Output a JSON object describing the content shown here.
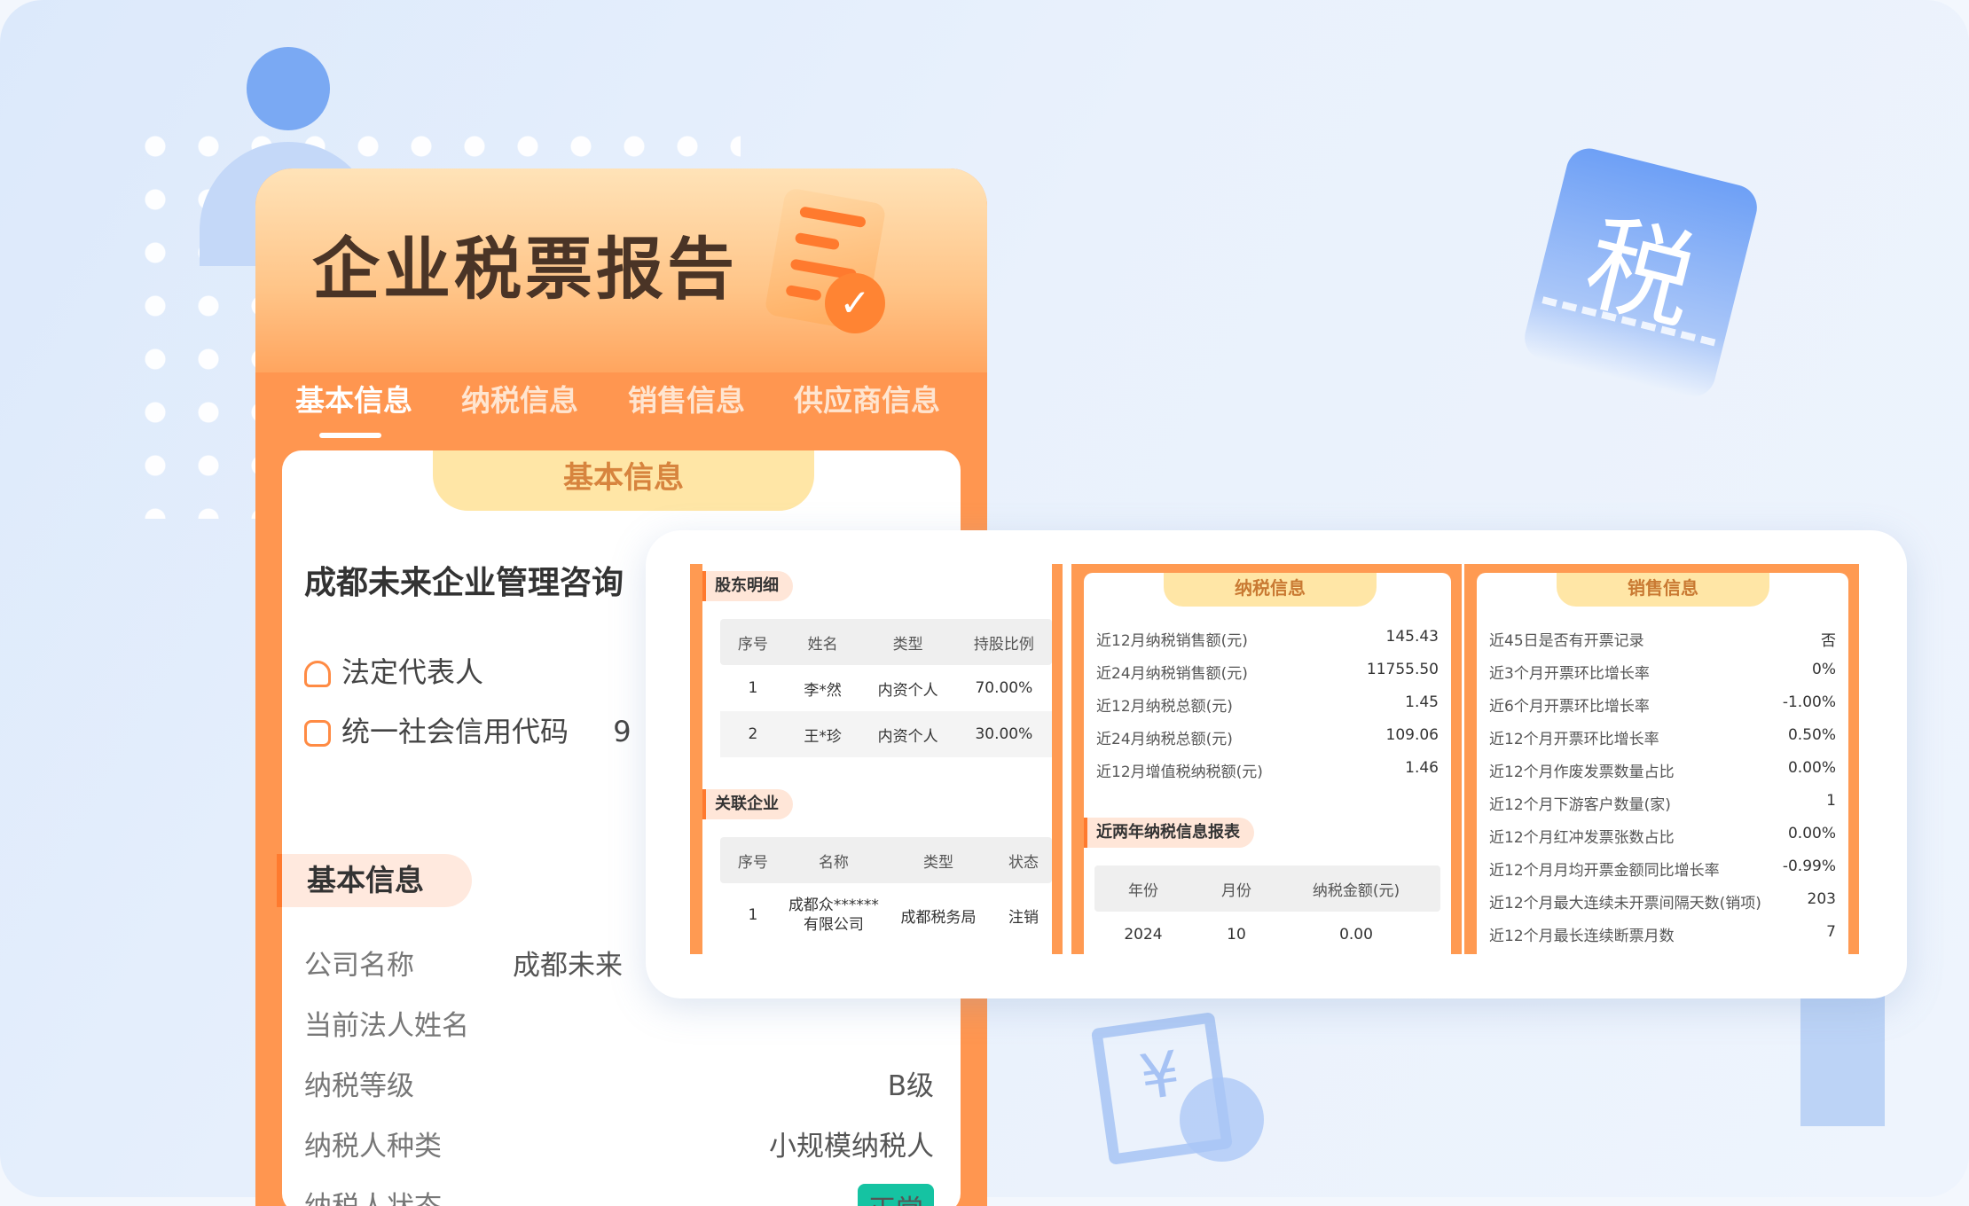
{
  "report_title": "企业税票报告",
  "tabs": [
    "基本信息",
    "纳税信息",
    "销售信息",
    "供应商信息"
  ],
  "card_header": "基本信息",
  "company_name": "成都未来企业管理咨询",
  "legal_rep_label": "法定代表人",
  "credit_code_label": "统一社会信用代码",
  "credit_code_value": "9",
  "section_title": "基本信息",
  "basic_rows": [
    {
      "label": "公司名称",
      "value": "成都未来"
    },
    {
      "label": "当前法人姓名",
      "value": ""
    },
    {
      "label": "纳税等级",
      "value": "B级"
    },
    {
      "label": "纳税人种类",
      "value": "小规模纳税人"
    },
    {
      "label": "纳税人状态",
      "value": "正常"
    }
  ],
  "shareholders": {
    "title": "股东明细",
    "headers": [
      "序号",
      "姓名",
      "类型",
      "持股比例"
    ],
    "rows": [
      [
        "1",
        "李*然",
        "内资个人",
        "70.00%"
      ],
      [
        "2",
        "王*珍",
        "内资个人",
        "30.00%"
      ]
    ]
  },
  "related": {
    "title": "关联企业",
    "headers": [
      "序号",
      "名称",
      "类型",
      "状态"
    ],
    "rows": [
      [
        "1",
        "成都众******有限公司",
        "成都税务局",
        "注销"
      ]
    ]
  },
  "tax_info": {
    "title": "纳税信息",
    "rows": [
      {
        "label": "近12月纳税销售额(元)",
        "value": "145.43"
      },
      {
        "label": "近24月纳税销售额(元)",
        "value": "11755.50"
      },
      {
        "label": "近12月纳税总额(元)",
        "value": "1.45"
      },
      {
        "label": "近24月纳税总额(元)",
        "value": "109.06"
      },
      {
        "label": "近12月增值税纳税额(元)",
        "value": "1.46"
      }
    ],
    "report_title": "近两年纳税信息报表",
    "report_headers": [
      "年份",
      "月份",
      "纳税金额(元)"
    ],
    "report_rows": [
      [
        "2024",
        "10",
        "0.00"
      ]
    ]
  },
  "sales_info": {
    "title": "销售信息",
    "rows": [
      {
        "label": "近45日是否有开票记录",
        "value": "否"
      },
      {
        "label": "近3个月开票环比增长率",
        "value": "0%"
      },
      {
        "label": "近6个月开票环比增长率",
        "value": "-1.00%"
      },
      {
        "label": "近12个月开票环比增长率",
        "value": "0.50%"
      },
      {
        "label": "近12个月作废发票数量占比",
        "value": "0.00%"
      },
      {
        "label": "近12个月下游客户数量(家)",
        "value": "1"
      },
      {
        "label": "近12个月红冲发票张数占比",
        "value": "0.00%"
      },
      {
        "label": "近12个月月均开票金额同比增长率",
        "value": "-0.99%"
      },
      {
        "label": "近12个月最大连续未开票间隔天数(销项)",
        "value": "203"
      },
      {
        "label": "近12个月最长连续断票月数",
        "value": "7"
      }
    ]
  },
  "decor": {
    "tax_glyph": "税",
    "yen_glyph": "¥",
    "check_glyph": "✓"
  }
}
